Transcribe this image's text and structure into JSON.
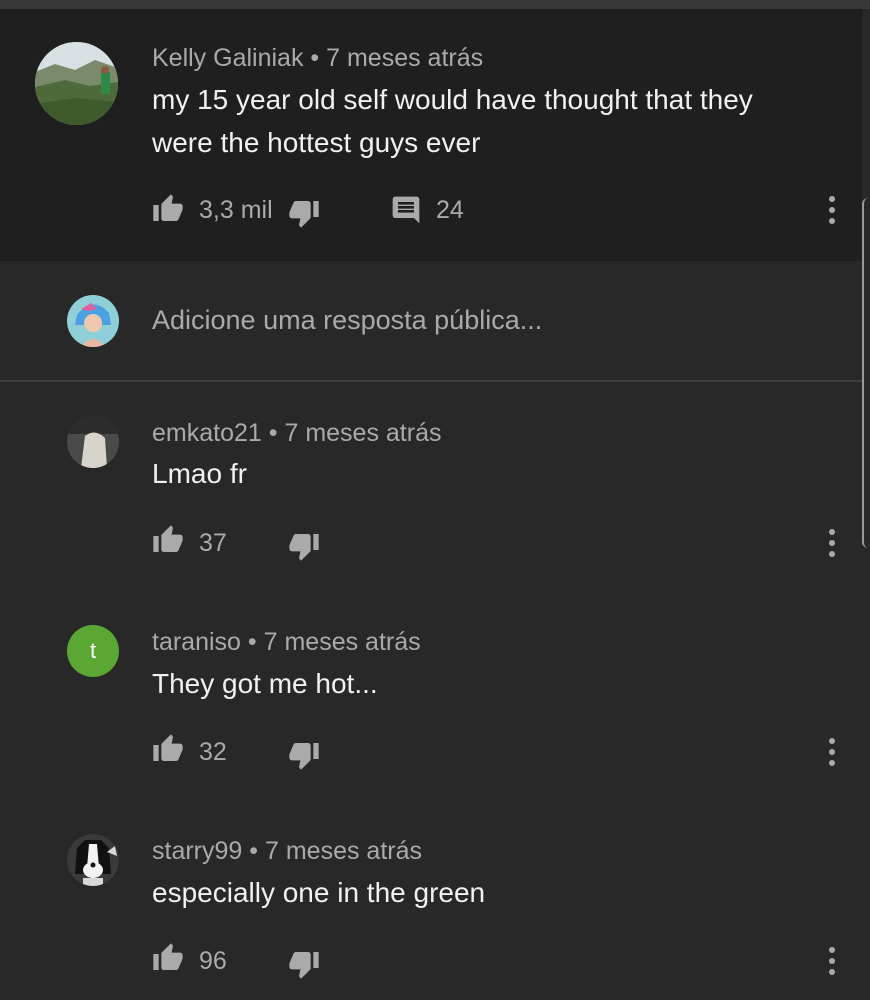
{
  "main_comment": {
    "author": "Kelly Galiniak",
    "separator": "•",
    "time": "7 meses atrás",
    "text_line1": "my 15 year old self would have thought that they",
    "text_line2": "were the hottest guys ever",
    "likes": "3,3 mil",
    "replies": "24",
    "avatar_icon": "landscape-avatar-icon"
  },
  "reply_box": {
    "placeholder": "Adicione uma resposta pública...",
    "avatar_icon": "user-avatar-icon"
  },
  "replies": [
    {
      "author": "emkato21",
      "separator": "•",
      "time": "7 meses atrás",
      "text": "Lmao fr",
      "likes": "37",
      "avatar_icon": "photo-avatar-icon"
    },
    {
      "author": "taraniso",
      "separator": "•",
      "time": "7 meses atrás",
      "text": "They got me hot...",
      "likes": "32",
      "avatar_letter": "t",
      "avatar_color": "#5ba734"
    },
    {
      "author": "starry99",
      "separator": "•",
      "time": "7 meses atrás",
      "text": "especially one in the green",
      "likes": "96",
      "avatar_icon": "dog-avatar-icon"
    }
  ],
  "colors": {
    "background": "#282828",
    "highlight_background": "#1f1f1f",
    "secondary_text": "#aaaaaa",
    "primary_text": "#f1f1f1"
  }
}
